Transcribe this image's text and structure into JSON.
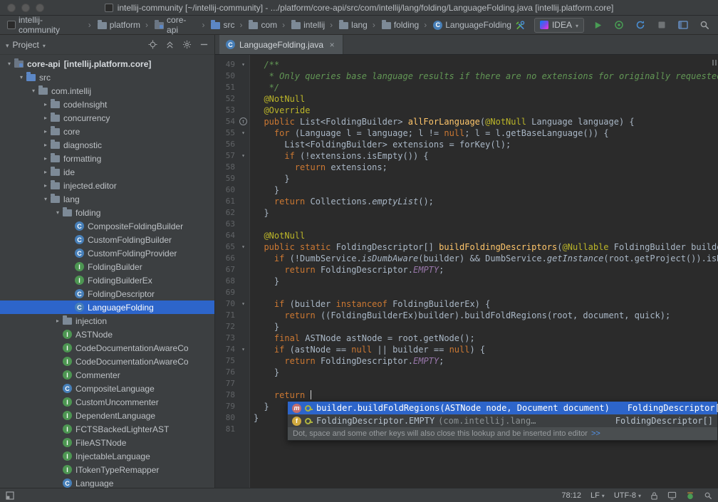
{
  "title_bar": {
    "title": "intellij-community [~/intellij-community] - .../platform/core-api/src/com/intellij/lang/folding/LanguageFolding.java [intellij.platform.core]"
  },
  "toolbar": {
    "crumbs": [
      {
        "label": "intellij-community",
        "icon": "project-icon"
      },
      {
        "label": "platform",
        "icon": "folder-icon"
      },
      {
        "label": "core-api",
        "icon": "module-icon"
      },
      {
        "label": "src",
        "icon": "src-folder-icon"
      },
      {
        "label": "com",
        "icon": "folder-icon"
      },
      {
        "label": "intellij",
        "icon": "folder-icon"
      },
      {
        "label": "lang",
        "icon": "folder-icon"
      },
      {
        "label": "folding",
        "icon": "folder-icon"
      },
      {
        "label": "LanguageFolding",
        "icon": "class-icon"
      }
    ],
    "run_config_label": "IDEA"
  },
  "project_panel": {
    "title": "Project",
    "tree": [
      {
        "depth": 0,
        "arrow": "expanded",
        "icon": "module-icon",
        "label": "core-api",
        "extra": "[intellij.platform.core]",
        "bold": true
      },
      {
        "depth": 1,
        "arrow": "expanded",
        "icon": "src-folder-icon",
        "label": "src"
      },
      {
        "depth": 2,
        "arrow": "expanded",
        "icon": "package-icon",
        "label": "com.intellij"
      },
      {
        "depth": 3,
        "arrow": "collapsed",
        "icon": "folder-icon",
        "label": "codeInsight"
      },
      {
        "depth": 3,
        "arrow": "collapsed",
        "icon": "folder-icon",
        "label": "concurrency"
      },
      {
        "depth": 3,
        "arrow": "collapsed",
        "icon": "folder-icon",
        "label": "core"
      },
      {
        "depth": 3,
        "arrow": "collapsed",
        "icon": "folder-icon",
        "label": "diagnostic"
      },
      {
        "depth": 3,
        "arrow": "collapsed",
        "icon": "folder-icon",
        "label": "formatting"
      },
      {
        "depth": 3,
        "arrow": "collapsed",
        "icon": "folder-icon",
        "label": "ide"
      },
      {
        "depth": 3,
        "arrow": "collapsed",
        "icon": "folder-icon",
        "label": "injected.editor"
      },
      {
        "depth": 3,
        "arrow": "expanded",
        "icon": "folder-icon",
        "label": "lang"
      },
      {
        "depth": 4,
        "arrow": "expanded",
        "icon": "folder-icon",
        "label": "folding"
      },
      {
        "depth": 5,
        "icon": "class-icon",
        "label": "CompositeFoldingBuilder"
      },
      {
        "depth": 5,
        "icon": "class-icon",
        "label": "CustomFoldingBuilder"
      },
      {
        "depth": 5,
        "icon": "class-icon",
        "label": "CustomFoldingProvider"
      },
      {
        "depth": 5,
        "icon": "interface-icon",
        "label": "FoldingBuilder"
      },
      {
        "depth": 5,
        "icon": "interface-icon",
        "label": "FoldingBuilderEx"
      },
      {
        "depth": 5,
        "icon": "class-icon",
        "label": "FoldingDescriptor"
      },
      {
        "depth": 5,
        "icon": "class-icon",
        "label": "LanguageFolding",
        "selected": true
      },
      {
        "depth": 4,
        "arrow": "collapsed",
        "icon": "folder-icon",
        "label": "injection"
      },
      {
        "depth": 4,
        "icon": "interface-icon",
        "label": "ASTNode"
      },
      {
        "depth": 4,
        "icon": "interface-icon",
        "label": "CodeDocumentationAwareCo"
      },
      {
        "depth": 4,
        "icon": "interface-icon",
        "label": "CodeDocumentationAwareCo"
      },
      {
        "depth": 4,
        "icon": "interface-icon",
        "label": "Commenter"
      },
      {
        "depth": 4,
        "icon": "class-icon",
        "label": "CompositeLanguage"
      },
      {
        "depth": 4,
        "icon": "interface-icon",
        "label": "CustomUncommenter"
      },
      {
        "depth": 4,
        "icon": "interface-icon",
        "label": "DependentLanguage"
      },
      {
        "depth": 4,
        "icon": "interface-icon",
        "label": "FCTSBackedLighterAST"
      },
      {
        "depth": 4,
        "icon": "interface-icon",
        "label": "FileASTNode"
      },
      {
        "depth": 4,
        "icon": "interface-icon",
        "label": "InjectableLanguage"
      },
      {
        "depth": 4,
        "icon": "interface-icon",
        "label": "ITokenTypeRemapper"
      },
      {
        "depth": 4,
        "icon": "class-icon",
        "label": "Language"
      }
    ]
  },
  "editor": {
    "tab_label": "LanguageFolding.java",
    "lines": [
      {
        "n": 49,
        "fold": "minus",
        "segs": [
          [
            "d",
            "  /**"
          ]
        ]
      },
      {
        "n": 50,
        "segs": [
          [
            "d",
            "   * Only queries base language results if there are no extensions for originally requested"
          ]
        ]
      },
      {
        "n": 51,
        "segs": [
          [
            "d",
            "   */"
          ]
        ]
      },
      {
        "n": 52,
        "segs": [
          [
            "a",
            "  @NotNull"
          ]
        ]
      },
      {
        "n": 53,
        "segs": [
          [
            "a",
            "  @Override"
          ]
        ]
      },
      {
        "n": 54,
        "fold": "override",
        "segs": [
          [
            "k",
            "  public"
          ],
          [
            "p",
            " List<FoldingBuilder> "
          ],
          [
            "m",
            "allForLanguage"
          ],
          [
            "p",
            "("
          ],
          [
            "a",
            "@NotNull"
          ],
          [
            "p",
            " Language language) {"
          ]
        ]
      },
      {
        "n": 55,
        "fold": "minus",
        "segs": [
          [
            "p",
            "    "
          ],
          [
            "k",
            "for"
          ],
          [
            "p",
            " (Language l = language; l != "
          ],
          [
            "k",
            "null"
          ],
          [
            "p",
            "; l = l.getBaseLanguage()) {"
          ]
        ]
      },
      {
        "n": 56,
        "segs": [
          [
            "p",
            "      List<FoldingBuilder> extensions = forKey(l);"
          ]
        ]
      },
      {
        "n": 57,
        "fold": "minus",
        "segs": [
          [
            "p",
            "      "
          ],
          [
            "k",
            "if"
          ],
          [
            "p",
            " (!extensions.isEmpty()) {"
          ]
        ]
      },
      {
        "n": 58,
        "segs": [
          [
            "p",
            "        "
          ],
          [
            "k",
            "return"
          ],
          [
            "p",
            " extensions;"
          ]
        ]
      },
      {
        "n": 59,
        "segs": [
          [
            "p",
            "      }"
          ]
        ]
      },
      {
        "n": 60,
        "segs": [
          [
            "p",
            "    }"
          ]
        ]
      },
      {
        "n": 61,
        "segs": [
          [
            "p",
            "    "
          ],
          [
            "k",
            "return"
          ],
          [
            "p",
            " Collections."
          ],
          [
            "i",
            "emptyList"
          ],
          [
            "p",
            "();"
          ]
        ]
      },
      {
        "n": 62,
        "segs": [
          [
            "p",
            "  }"
          ]
        ]
      },
      {
        "n": 63,
        "segs": []
      },
      {
        "n": 64,
        "segs": [
          [
            "a",
            "  @NotNull"
          ]
        ]
      },
      {
        "n": 65,
        "fold": "minus",
        "segs": [
          [
            "k",
            "  public static"
          ],
          [
            "p",
            " FoldingDescriptor[] "
          ],
          [
            "m",
            "buildFoldingDescriptors"
          ],
          [
            "p",
            "("
          ],
          [
            "a",
            "@Nullable"
          ],
          [
            "p",
            " FoldingBuilder builder"
          ]
        ]
      },
      {
        "n": 66,
        "segs": [
          [
            "p",
            "    "
          ],
          [
            "k",
            "if"
          ],
          [
            "p",
            " (!DumbService."
          ],
          [
            "i",
            "isDumbAware"
          ],
          [
            "p",
            "(builder) && DumbService."
          ],
          [
            "i",
            "getInstance"
          ],
          [
            "p",
            "(root.getProject()).isDum"
          ]
        ]
      },
      {
        "n": 67,
        "segs": [
          [
            "p",
            "      "
          ],
          [
            "k",
            "return"
          ],
          [
            "p",
            " FoldingDescriptor."
          ],
          [
            "f",
            "EMPTY"
          ],
          [
            "p",
            ";"
          ]
        ]
      },
      {
        "n": 68,
        "segs": [
          [
            "p",
            "    }"
          ]
        ]
      },
      {
        "n": 69,
        "segs": []
      },
      {
        "n": 70,
        "fold": "minus",
        "segs": [
          [
            "p",
            "    "
          ],
          [
            "k",
            "if"
          ],
          [
            "p",
            " (builder "
          ],
          [
            "k",
            "instanceof"
          ],
          [
            "p",
            " FoldingBuilderEx) {"
          ]
        ]
      },
      {
        "n": 71,
        "segs": [
          [
            "p",
            "      "
          ],
          [
            "k",
            "return"
          ],
          [
            "p",
            " ((FoldingBuilderEx)builder).buildFoldRegions(root, document, quick);"
          ]
        ]
      },
      {
        "n": 72,
        "segs": [
          [
            "p",
            "    }"
          ]
        ]
      },
      {
        "n": 73,
        "segs": [
          [
            "p",
            "    "
          ],
          [
            "k",
            "final"
          ],
          [
            "p",
            " ASTNode astNode = root.getNode();"
          ]
        ]
      },
      {
        "n": 74,
        "fold": "minus",
        "segs": [
          [
            "p",
            "    "
          ],
          [
            "k",
            "if"
          ],
          [
            "p",
            " (astNode == "
          ],
          [
            "k",
            "null"
          ],
          [
            "p",
            " || builder == "
          ],
          [
            "k",
            "null"
          ],
          [
            "p",
            ") {"
          ]
        ]
      },
      {
        "n": 75,
        "segs": [
          [
            "p",
            "      "
          ],
          [
            "k",
            "return"
          ],
          [
            "p",
            " FoldingDescriptor."
          ],
          [
            "f",
            "EMPTY"
          ],
          [
            "p",
            ";"
          ]
        ]
      },
      {
        "n": 76,
        "segs": [
          [
            "p",
            "    }"
          ]
        ]
      },
      {
        "n": 77,
        "segs": []
      },
      {
        "n": 78,
        "caret": true,
        "segs": [
          [
            "p",
            "    "
          ],
          [
            "k",
            "return"
          ],
          [
            "p",
            " "
          ]
        ]
      },
      {
        "n": 79,
        "segs": [
          [
            "p",
            "  }"
          ]
        ]
      },
      {
        "n": 80,
        "segs": [
          [
            "p",
            "}"
          ]
        ]
      },
      {
        "n": 81,
        "segs": []
      }
    ]
  },
  "completion": {
    "items": [
      {
        "icon": "method-icon",
        "icon2": "key-icon",
        "label": "builder.buildFoldRegions(ASTNode node, Document document)",
        "tail": "FoldingDescriptor[]",
        "selected": true
      },
      {
        "icon": "field-icon",
        "icon2": "key-icon",
        "label": "FoldingDescriptor.EMPTY",
        "note": "(com.intellij.lang…",
        "tail": "FoldingDescriptor[]",
        "selected": false
      }
    ],
    "hint": "Dot, space and some other keys will also close this lookup and be inserted into editor",
    "hint_link": ">>"
  },
  "status_bar": {
    "position": "78:12",
    "line_separator": "LF",
    "encoding": "UTF-8"
  },
  "colors": {
    "selection-blue": "#2d65ca",
    "editor-bg": "#2b2b2b",
    "panel-bg": "#3c3f41",
    "keyword": "#cc7832",
    "annotation": "#bbb529",
    "javadoc": "#629755",
    "method-decl": "#ffc66b",
    "constant": "#9876aa",
    "plain-text": "#a9b7c6",
    "line-number": "#606366",
    "run-green": "#499c54"
  }
}
